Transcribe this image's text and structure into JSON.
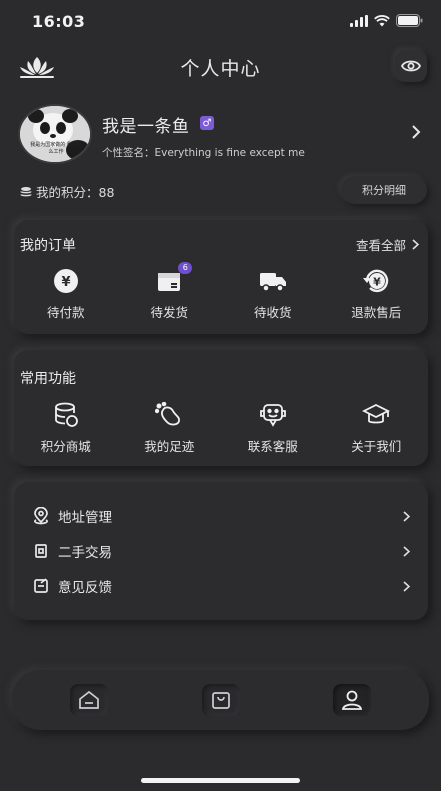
{
  "status_bar": {
    "time": "16:03"
  },
  "header": {
    "title": "个人中心"
  },
  "profile": {
    "avatar_caption": "我是为国家做的 我做什么工作",
    "nickname": "我是一条鱼",
    "gender_symbol": "♂",
    "signature": "个性签名：Everything is fine except me",
    "points_label": "我的积分：88",
    "points_detail_button": "积分明细"
  },
  "orders": {
    "title": "我的订单",
    "view_all": "查看全部",
    "items": [
      {
        "label": "待付款",
        "icon": "yen-coin-icon",
        "badge": ""
      },
      {
        "label": "待发货",
        "icon": "package-icon",
        "badge": "6"
      },
      {
        "label": "待收货",
        "icon": "truck-icon",
        "badge": ""
      },
      {
        "label": "退款售后",
        "icon": "refund-icon",
        "badge": ""
      }
    ]
  },
  "functions": {
    "title": "常用功能",
    "items": [
      {
        "label": "积分商城",
        "icon": "coin-stack-icon"
      },
      {
        "label": "我的足迹",
        "icon": "footprint-icon"
      },
      {
        "label": "联系客服",
        "icon": "customer-service-icon"
      },
      {
        "label": "关于我们",
        "icon": "graduation-cap-icon"
      }
    ]
  },
  "menu": [
    {
      "label": "地址管理",
      "icon": "location-icon"
    },
    {
      "label": "二手交易",
      "icon": "trade-icon"
    },
    {
      "label": "意见反馈",
      "icon": "feedback-icon"
    }
  ],
  "tabbar": {
    "tabs": [
      {
        "icon": "home-icon",
        "active": false
      },
      {
        "icon": "shopping-bag-icon",
        "active": false
      },
      {
        "icon": "profile-icon",
        "active": true
      }
    ]
  },
  "colors": {
    "background": "#2b2b2d",
    "accent": "#7c5cd6",
    "text": "#e6e6e8"
  }
}
